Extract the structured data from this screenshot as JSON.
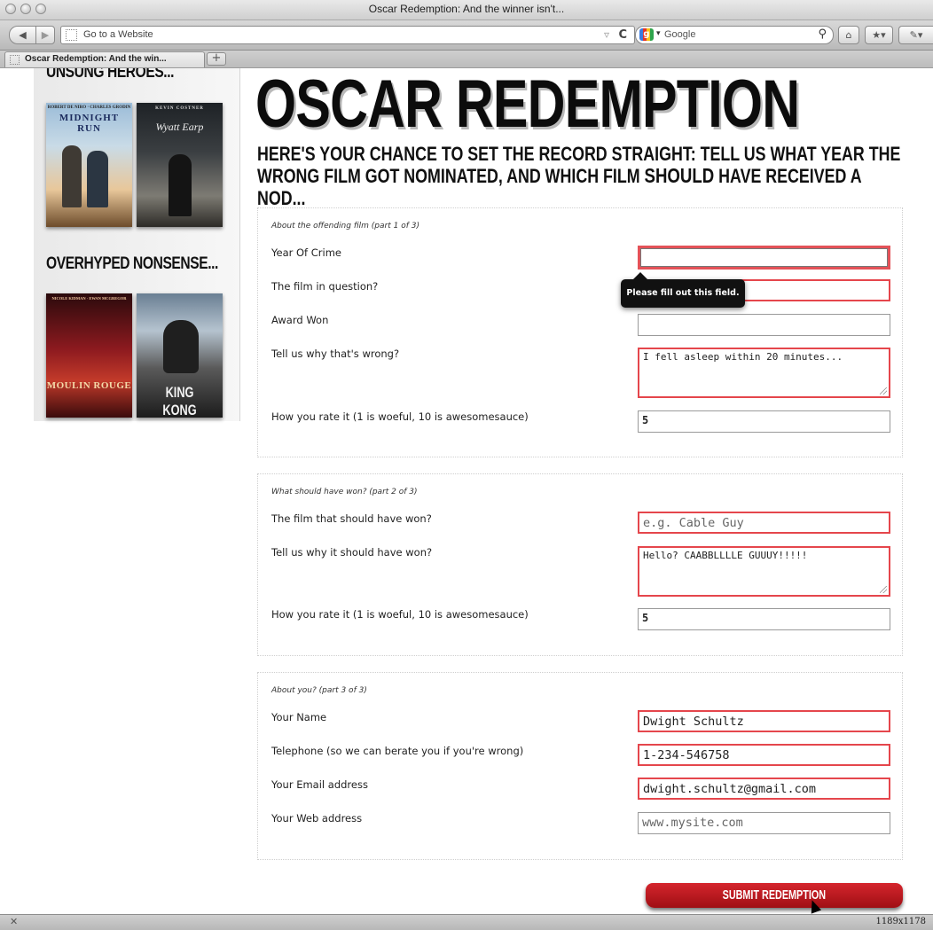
{
  "window": {
    "title": "Oscar Redemption: And the winner isn't...",
    "size_readout": "1189x1178"
  },
  "toolbar": {
    "back_icon": "back-arrow-icon",
    "forward_icon": "forward-arrow-icon",
    "address_placeholder": "Go to a Website",
    "search_engine": "Google"
  },
  "tabs": [
    {
      "label": "Oscar Redemption: And the win..."
    }
  ],
  "sidebar": {
    "section1_heading": "UNSUNG HEROES...",
    "section1_posters": [
      {
        "title": "MIDNIGHT RUN",
        "tagline": "ROBERT DE NIRO · CHARLES GRODIN"
      },
      {
        "title": "Wyatt Earp",
        "tagline": "KEVIN COSTNER"
      }
    ],
    "section2_heading": "OVERHYPED NONSENSE...",
    "section2_posters": [
      {
        "title": "MOULIN ROUGE",
        "tagline": "NICOLE KIDMAN · EWAN MCGREGOR"
      },
      {
        "title": "KING KONG",
        "tagline": ""
      }
    ]
  },
  "main": {
    "title": "OSCAR REDEMPTION",
    "intro_before": "Here's your chance to set the record straight: tell us what year the wrong film got nominated, and which film ",
    "intro_emphasis": "should",
    "intro_after": " have received a nod..."
  },
  "form": {
    "part1": {
      "legend": "About the offending film (part 1 of 3)",
      "year_label": "Year Of Crime",
      "year_value": "",
      "film_label": "The film in question?",
      "film_value": "",
      "award_label": "Award Won",
      "award_value": "",
      "why_label": "Tell us why that's wrong?",
      "why_value": "I fell asleep within 20 minutes...",
      "rate_label": "How you rate it (1 is woeful, 10 is awesomesauce)",
      "rate_value": "5"
    },
    "tooltip": "Please fill out this field.",
    "part2": {
      "legend": "What should have won? (part 2 of 3)",
      "film_label": "The film that should have won?",
      "film_placeholder": "e.g. Cable Guy",
      "why_label": "Tell us why it should have won?",
      "why_value": "Hello? CAABBLLLLE GUUUY!!!!!",
      "rate_label": "How you rate it (1 is woeful, 10 is awesomesauce)",
      "rate_value": "5"
    },
    "part3": {
      "legend": "About you? (part 3 of 3)",
      "name_label": "Your Name",
      "name_value": "Dwight Schultz",
      "phone_label": "Telephone (so we can berate you if you're wrong)",
      "phone_value": "1-234-546758",
      "email_label": "Your Email address",
      "email_value": "dwight.schultz@gmail.com",
      "web_label": "Your Web address",
      "web_placeholder": "www.mysite.com"
    },
    "submit_label": "SUBMIT REDEMPTION"
  },
  "colors": {
    "accent_red": "#d5252d",
    "invalid_border": "#e5464c"
  }
}
